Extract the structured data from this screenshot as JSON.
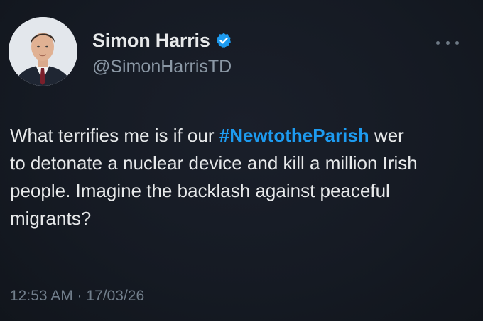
{
  "author": {
    "display_name": "Simon Harris",
    "handle": "@SimonHarrisTD",
    "verified": true,
    "badge_color": "#1d9bf0"
  },
  "tweet": {
    "line1_before": "What terrifies me is if our ",
    "hashtag": "#NewtotheParish",
    "line1_after": " wer",
    "line2": "to detonate a nuclear device and kill a million Irish",
    "line3": "people. Imagine the backlash against peaceful",
    "line4": "migrants?",
    "hashtag_color": "#1d9bf0"
  },
  "meta": {
    "timestamp": "12:53 AM · 17/03/26"
  },
  "icons": {
    "verified": "verified-badge-icon",
    "more": "more-options-icon"
  }
}
